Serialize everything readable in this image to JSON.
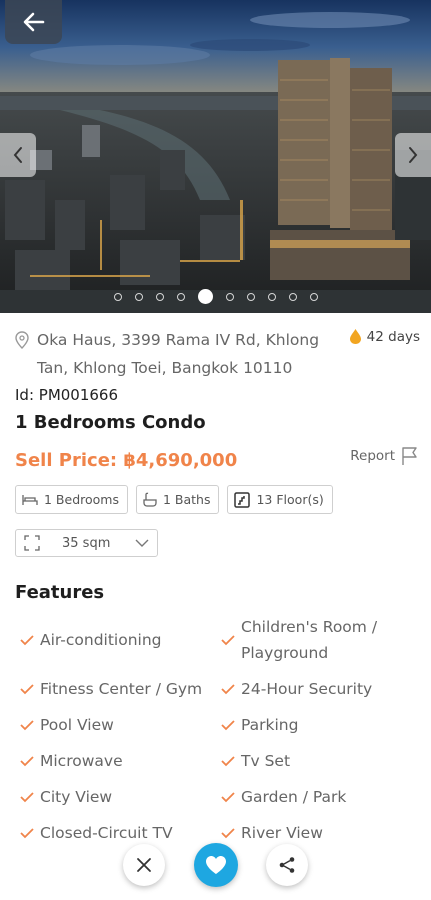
{
  "gallery": {
    "slide_count": 10,
    "active_slide": 4
  },
  "listing": {
    "address": "Oka Haus, 3399 Rama IV Rd, Khlong Tan, Khlong Toei, Bangkok 10110",
    "days_listed": "42 days",
    "id_label": "Id: PM001666",
    "title": "1 Bedrooms Condo",
    "price": "Sell Price: ฿4,690,000",
    "report_label": "Report"
  },
  "specs": {
    "bedrooms": "1 Bedrooms",
    "baths": "1 Baths",
    "floor": "13 Floor(s)",
    "size": "35 sqm"
  },
  "features": {
    "heading": "Features",
    "left": [
      "Air-conditioning",
      "Fitness Center / Gym",
      "Pool View",
      "Microwave",
      "City View",
      "Closed-Circuit TV"
    ],
    "right": [
      "Children's Room / Playground",
      "24-Hour Security",
      "Parking",
      "Tv Set",
      "Garden / Park",
      "River View"
    ]
  },
  "colors": {
    "accent": "#f0844a",
    "favorite": "#1ea7e1",
    "days_badge": "#f2a521"
  }
}
